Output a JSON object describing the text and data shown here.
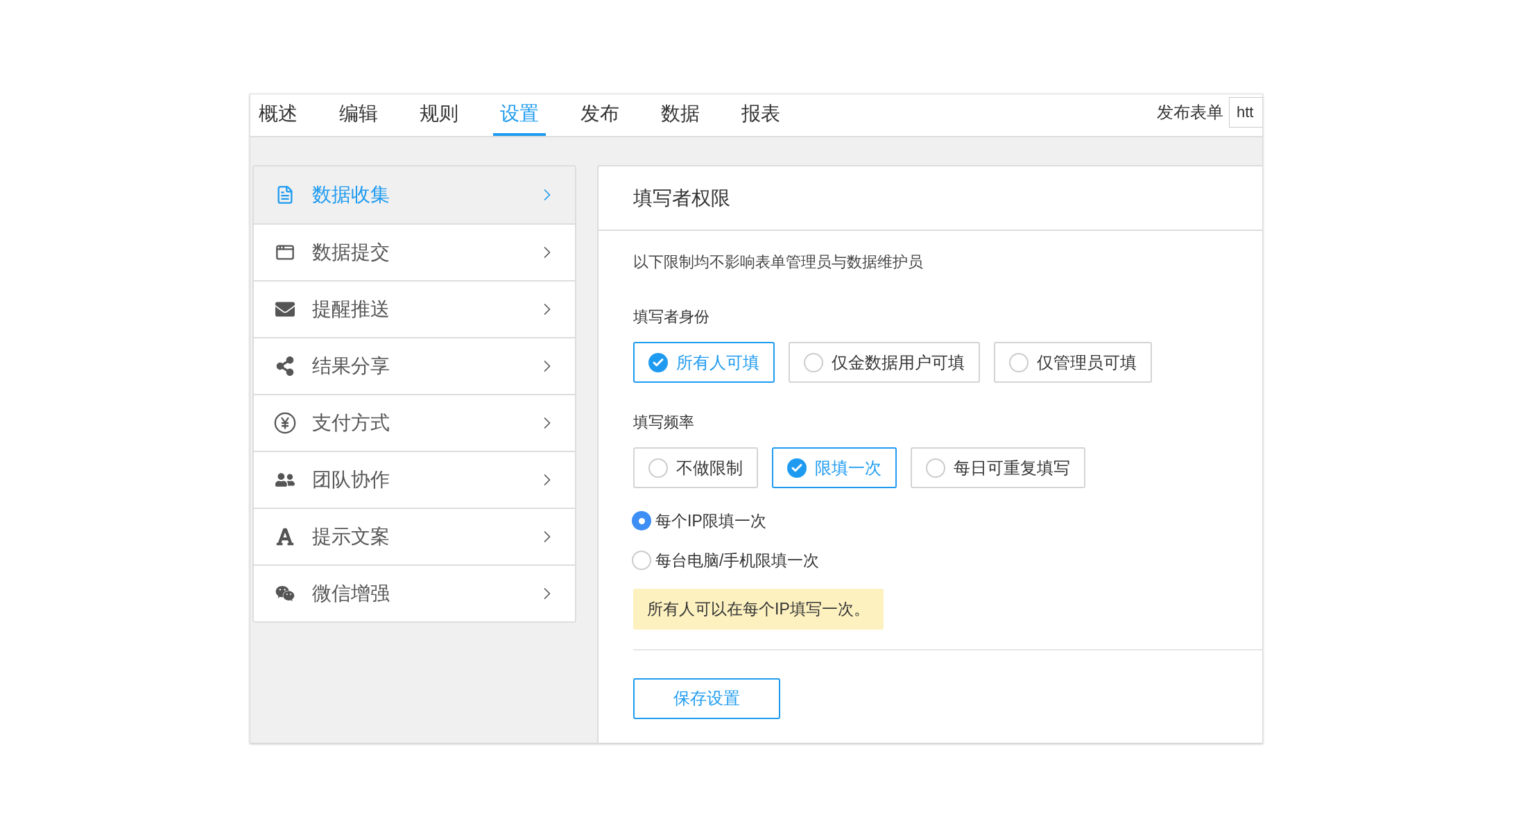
{
  "tabs": [
    {
      "label": "概述",
      "selected": false
    },
    {
      "label": "编辑",
      "selected": false
    },
    {
      "label": "规则",
      "selected": false
    },
    {
      "label": "设置",
      "selected": true
    },
    {
      "label": "发布",
      "selected": false
    },
    {
      "label": "数据",
      "selected": false
    },
    {
      "label": "报表",
      "selected": false
    }
  ],
  "publish": {
    "label": "发布表单",
    "value": "htt"
  },
  "sidebar": {
    "items": [
      {
        "label": "数据收集",
        "selected": true
      },
      {
        "label": "数据提交",
        "selected": false
      },
      {
        "label": "提醒推送",
        "selected": false
      },
      {
        "label": "结果分享",
        "selected": false
      },
      {
        "label": "支付方式",
        "selected": false
      },
      {
        "label": "团队协作",
        "selected": false
      },
      {
        "label": "提示文案",
        "selected": false
      },
      {
        "label": "微信增强",
        "selected": false
      }
    ]
  },
  "panel": {
    "title": "填写者权限",
    "description": "以下限制均不影响表单管理员与数据维护员",
    "identity": {
      "label": "填写者身份",
      "options": [
        {
          "label": "所有人可填",
          "selected": true
        },
        {
          "label": "仅金数据用户可填",
          "selected": false
        },
        {
          "label": "仅管理员可填",
          "selected": false
        }
      ]
    },
    "frequency": {
      "label": "填写频率",
      "options": [
        {
          "label": "不做限制",
          "selected": false
        },
        {
          "label": "限填一次",
          "selected": true
        },
        {
          "label": "每日可重复填写",
          "selected": false
        }
      ]
    },
    "limit_by": [
      {
        "label": "每个IP限填一次",
        "selected": true
      },
      {
        "label": "每台电脑/手机限填一次",
        "selected": false
      }
    ],
    "notice": "所有人可以在每个IP填写一次。",
    "save_button": "保存设置"
  }
}
